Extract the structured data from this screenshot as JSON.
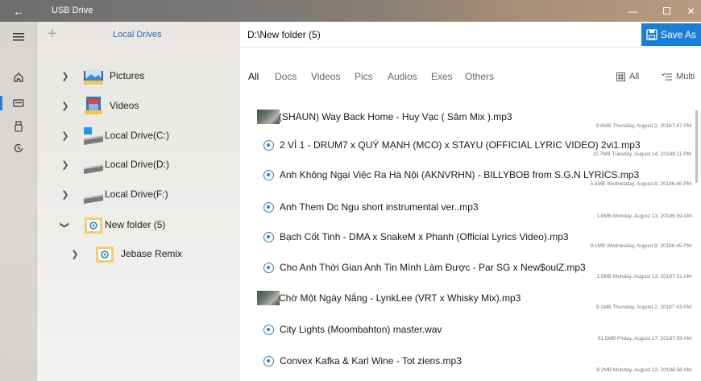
{
  "titlebar": {
    "title": "USB Drive"
  },
  "left": {
    "header": "Local Drives",
    "tree": [
      {
        "label": "Pictures",
        "icon": "pictures-folder-icon"
      },
      {
        "label": "Videos",
        "icon": "videos-folder-icon"
      },
      {
        "label": "Local Drive(C:)",
        "icon": "windows-drive-icon"
      },
      {
        "label": "Local Drive(D:)",
        "icon": "drive-icon"
      },
      {
        "label": "Local Drive(F:)",
        "icon": "drive-icon"
      },
      {
        "label": "New folder (5)",
        "icon": "folder-icon",
        "expanded": true
      },
      {
        "label": "Jebase Remix",
        "icon": "folder-icon"
      }
    ]
  },
  "main": {
    "path": "D:\\New folder (5)",
    "save_label": "Save As",
    "tabs": [
      "All",
      "Docs",
      "Videos",
      "Pics",
      "Audios",
      "Exes",
      "Others"
    ],
    "view_all": "All",
    "view_multi": "Multi",
    "files": [
      {
        "name": "(SHAUN) Way Back Home - Huy Vạc ( Sâm Mix ).mp3",
        "meta": "9.6MB  Thursday, August 2, 20187:47 PM",
        "icon": "thumbnail"
      },
      {
        "name": "2 VÌ 1 - DRUM7 x QUÝ MẠNH (MCO) x STAYU (OFFICIAL LYRIC VIDEO) 2vi1.mp3",
        "meta": "10.7MB  Tuesday, August 14, 20188:11 PM",
        "icon": "audio"
      },
      {
        "name": "Anh Không Ngại Việc Ra Hà Nội (AKNVRHN) - BILLYBOB from S.G.N  LYRICS.mp3",
        "meta": "5.5MB  Wednesday, August 8, 20186:46 PM",
        "icon": "audio"
      },
      {
        "name": "Anh Them Dc Ngu short instrumental ver..mp3",
        "meta": "1.8MB  Monday, August 13, 20186:59 AM",
        "icon": "audio"
      },
      {
        "name": "Bạch Cốt Tinh - DMA x SnakeM x Phanh (Official Lyrics Video).mp3",
        "meta": "9.1MB  Wednesday, August 8, 20186:45 PM",
        "icon": "audio"
      },
      {
        "name": "Cho Anh Thời Gian Anh Tin Mình Làm Được - Par SG x New$oulZ.mp3",
        "meta": "1.5MB  Monday, August 13, 20187:01 AM",
        "icon": "audio"
      },
      {
        "name": "Chờ Một Ngày Nắng - LynkLee (VRT x Whisky Mix).mp3",
        "meta": "9.1MB  Thursday, August 2, 20187:43 PM",
        "icon": "thumbnail"
      },
      {
        "name": "City Lights (Moombahton) master.wav",
        "meta": "91.5MB  Friday, August 17, 20187:59 AM",
        "icon": "audio"
      },
      {
        "name": "Convex Kafka & Karl Wine - Tot ziens.mp3",
        "meta": "8.2MB  Monday, August 13, 20186:58 AM",
        "icon": "audio"
      }
    ]
  },
  "colors": {
    "accent": "#1b7fd6",
    "link": "#2a6fb8"
  }
}
